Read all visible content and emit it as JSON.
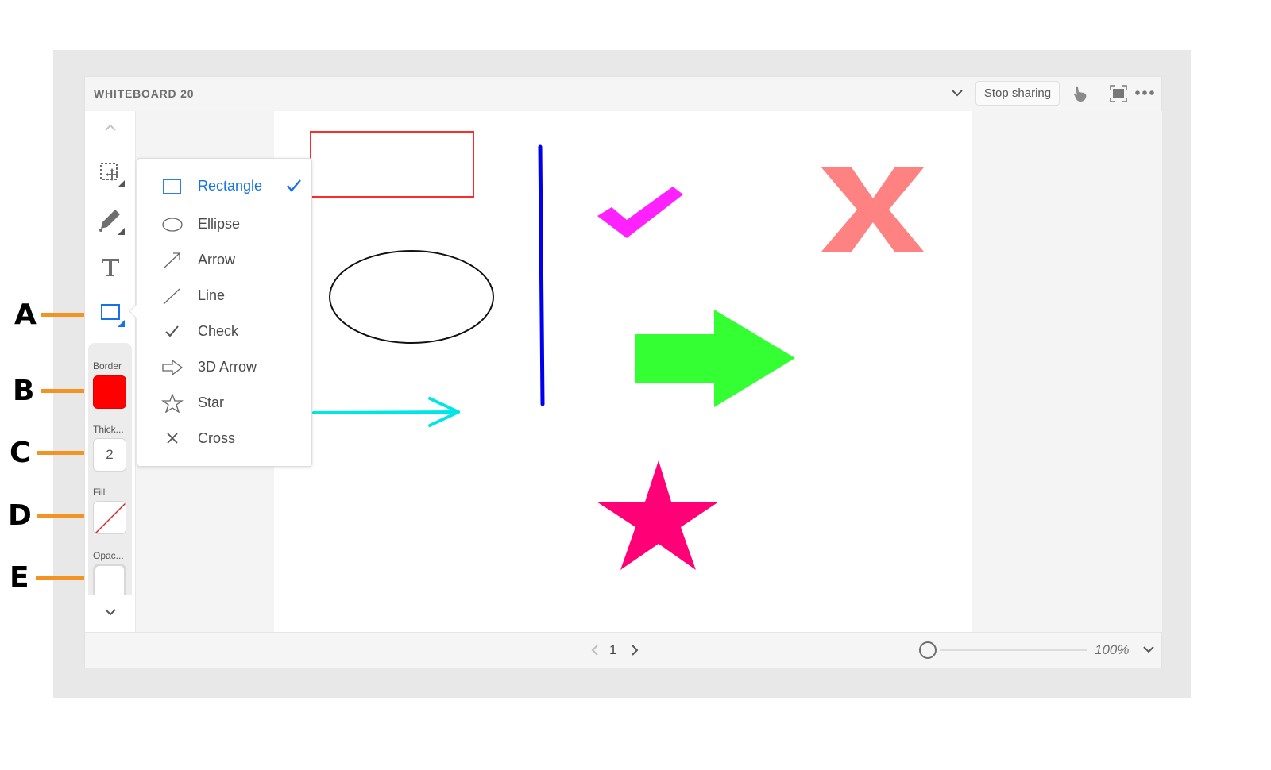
{
  "window": {
    "title": "WHITEBOARD 20",
    "stop_sharing_label": "Stop sharing"
  },
  "toolbar": {
    "tools": [
      {
        "name": "select",
        "icon": "select-move-icon"
      },
      {
        "name": "pencil",
        "icon": "pencil-icon"
      },
      {
        "name": "text",
        "icon": "text-icon"
      },
      {
        "name": "shape",
        "icon": "rectangle-icon",
        "active": true
      }
    ],
    "properties": {
      "border_label": "Border",
      "border_color": "#ff0000",
      "thickness_label": "Thick...",
      "thickness_value": "2",
      "fill_label": "Fill",
      "fill_value": "none",
      "opacity_label": "Opac..."
    }
  },
  "shape_menu": {
    "items": [
      {
        "label": "Rectangle",
        "icon": "rectangle-icon",
        "selected": true
      },
      {
        "label": "Ellipse",
        "icon": "ellipse-icon"
      },
      {
        "label": "Arrow",
        "icon": "arrow-icon"
      },
      {
        "label": "Line",
        "icon": "line-icon"
      },
      {
        "label": "Check",
        "icon": "check-icon"
      },
      {
        "label": "3D Arrow",
        "icon": "3d-arrow-icon"
      },
      {
        "label": "Star",
        "icon": "star-icon"
      },
      {
        "label": "Cross",
        "icon": "cross-icon"
      }
    ]
  },
  "canvas": {
    "shapes": [
      {
        "type": "rectangle",
        "stroke": "#ff2a2a",
        "fill": "none"
      },
      {
        "type": "ellipse",
        "stroke": "#111111",
        "fill": "none"
      },
      {
        "type": "arrow",
        "stroke": "#00e6e6"
      },
      {
        "type": "line",
        "stroke": "#0000ee"
      },
      {
        "type": "check",
        "fill": "#ff22ff"
      },
      {
        "type": "cross",
        "fill": "#ff8282"
      },
      {
        "type": "3d-arrow",
        "fill": "#33ff33"
      },
      {
        "type": "star",
        "fill": "#ff0077"
      }
    ]
  },
  "footer": {
    "page": "1",
    "zoom": "100%",
    "zoom_level": 0
  },
  "callouts": [
    "A",
    "B",
    "C",
    "D",
    "E"
  ],
  "colors": {
    "accent": "#1473e6",
    "callout_line": "#f39323"
  }
}
